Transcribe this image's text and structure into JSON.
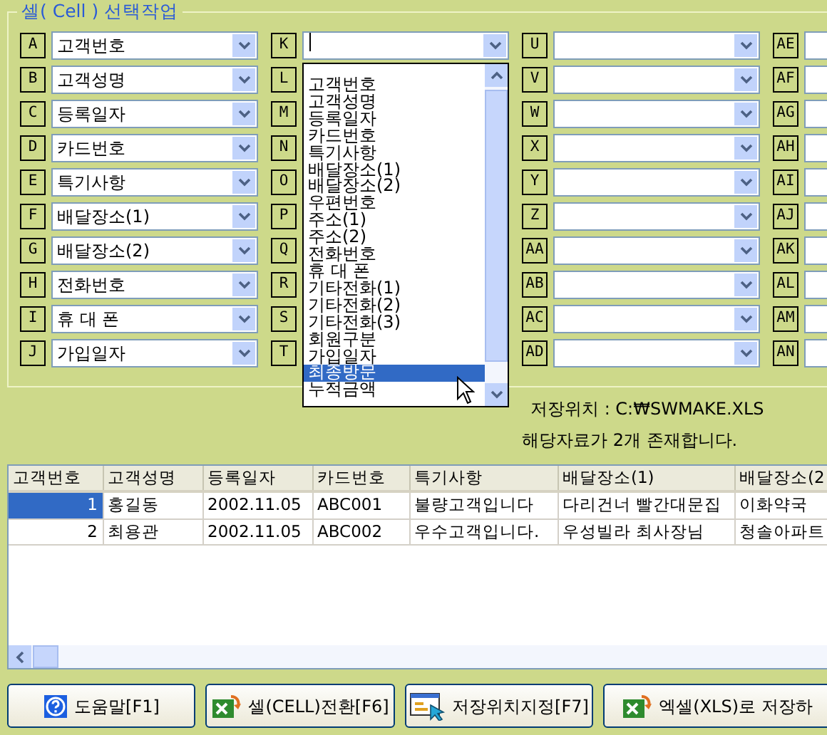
{
  "group": {
    "title": "셀( Cell ) 선택작업"
  },
  "fields": [
    {
      "code": "A",
      "value": "고객번호"
    },
    {
      "code": "B",
      "value": "고객성명"
    },
    {
      "code": "C",
      "value": "등록일자"
    },
    {
      "code": "D",
      "value": "카드번호"
    },
    {
      "code": "E",
      "value": "특기사항"
    },
    {
      "code": "F",
      "value": "배달장소(1)"
    },
    {
      "code": "G",
      "value": "배달장소(2)"
    },
    {
      "code": "H",
      "value": "전화번호"
    },
    {
      "code": "I",
      "value": "휴 대 폰"
    },
    {
      "code": "J",
      "value": "가입일자"
    },
    {
      "code": "K",
      "dropdown": {
        "items": [
          {
            "label": "고객번호",
            "selected": false
          },
          {
            "label": "고객성명",
            "selected": false
          },
          {
            "label": "등록일자",
            "selected": false
          },
          {
            "label": "카드번호",
            "selected": false
          },
          {
            "label": "특기사항",
            "selected": false
          },
          {
            "label": "배달장소(1)",
            "selected": false
          },
          {
            "label": "배달장소(2)",
            "selected": false
          },
          {
            "label": "우편번호",
            "selected": false
          },
          {
            "label": "주소(1)",
            "selected": false
          },
          {
            "label": "주소(2)",
            "selected": false
          },
          {
            "label": "전화번호",
            "selected": false
          },
          {
            "label": "휴 대 폰",
            "selected": false
          },
          {
            "label": "기타전화(1)",
            "selected": false
          },
          {
            "label": "기타전화(2)",
            "selected": false
          },
          {
            "label": "기타전화(3)",
            "selected": false
          },
          {
            "label": "회원구분",
            "selected": false
          },
          {
            "label": "가입일자",
            "selected": false
          },
          {
            "label": "최종방문",
            "selected": true
          },
          {
            "label": "누적금액",
            "selected": false
          }
        ]
      }
    },
    {
      "code": "L"
    },
    {
      "code": "M"
    },
    {
      "code": "N"
    },
    {
      "code": "O"
    },
    {
      "code": "P"
    },
    {
      "code": "Q"
    },
    {
      "code": "R"
    },
    {
      "code": "S"
    },
    {
      "code": "T"
    },
    {
      "code": "U"
    },
    {
      "code": "V"
    },
    {
      "code": "W"
    },
    {
      "code": "X"
    },
    {
      "code": "Y"
    },
    {
      "code": "Z"
    },
    {
      "code": "AA"
    },
    {
      "code": "AB"
    },
    {
      "code": "AC"
    },
    {
      "code": "AD"
    },
    {
      "code": "AE"
    },
    {
      "code": "AF"
    },
    {
      "code": "AG"
    },
    {
      "code": "AH"
    },
    {
      "code": "AI"
    },
    {
      "code": "AJ"
    },
    {
      "code": "AK"
    },
    {
      "code": "AL"
    },
    {
      "code": "AM"
    },
    {
      "code": "AN"
    }
  ],
  "save_path": "저장위치 : C:₩SWMAKE.XLS",
  "record_count": "해당자료가 2개 존재합니다.",
  "table": {
    "columns": [
      "고객번호",
      "고객성명",
      "등록일자",
      "카드번호",
      "특기사항",
      "배달장소(1)",
      "배달장소(2"
    ],
    "rows": [
      {
        "selected": true,
        "cells": [
          "1",
          "홍길동",
          "2002.11.05",
          "ABC001",
          "불량고객입니다",
          "다리건너 빨간대문집",
          "이화약국"
        ]
      },
      {
        "selected": false,
        "cells": [
          "2",
          "최용관",
          "2002.11.05",
          "ABC002",
          "우수고객입니다.",
          "우성빌라 최사장님",
          "청솔아파트"
        ]
      }
    ]
  },
  "buttons": [
    {
      "label": "도움말[F1]",
      "kind": "help"
    },
    {
      "label": "셀(CELL)전환[F6]",
      "kind": "excel"
    },
    {
      "label": "저장위치지정[F7]",
      "kind": "folder"
    },
    {
      "label": "엑셀(XLS)로 저장하",
      "kind": "excel"
    }
  ]
}
